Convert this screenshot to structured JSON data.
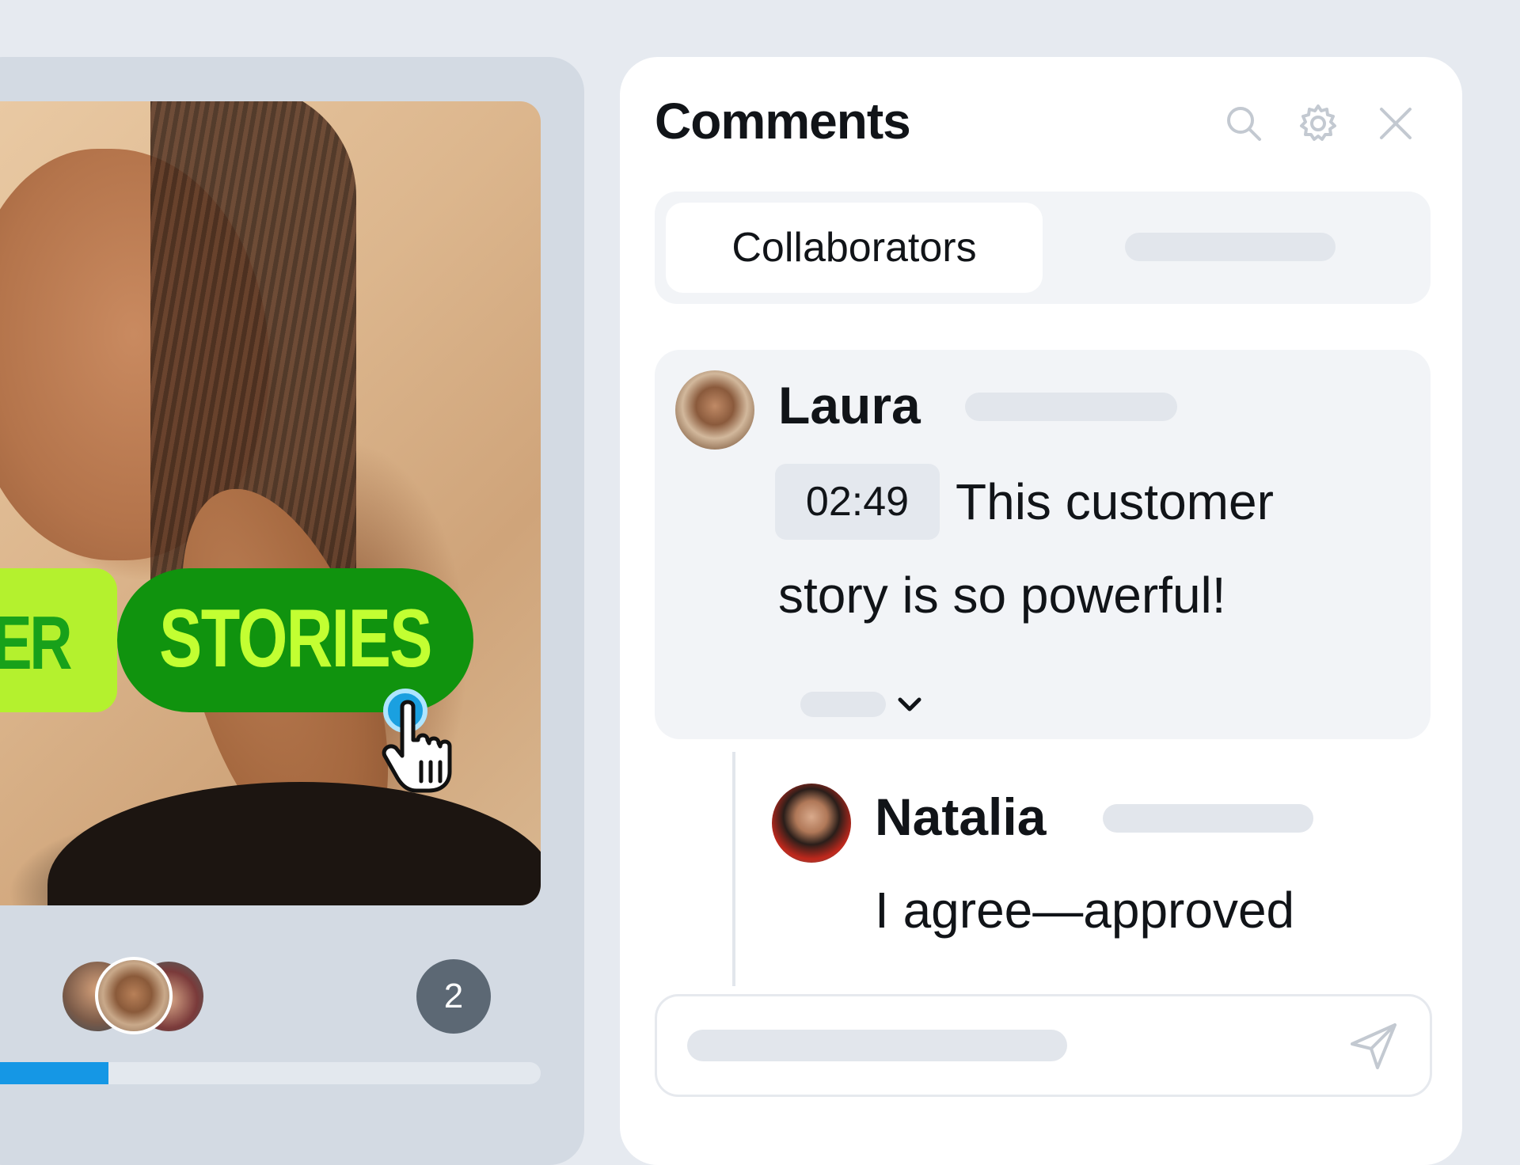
{
  "media": {
    "label_partial": "ER",
    "label_main": "STORIES"
  },
  "timeline": {
    "viewer_count": "2",
    "progress_fraction": 0.2
  },
  "comments": {
    "title": "Comments",
    "tabs": [
      "Collaborators"
    ],
    "thread": {
      "author": "Laura",
      "timestamp": "02:49",
      "text_line1": "This customer",
      "text_line2": "story is so powerful!"
    },
    "reply": {
      "author": "Natalia",
      "text": "I agree—approved"
    }
  },
  "icons": {
    "search": "search-icon",
    "settings": "gear-icon",
    "close": "close-icon",
    "expand": "chevron-down-icon",
    "send": "send-icon",
    "cursor": "hand-cursor-icon"
  },
  "colors": {
    "label_green": "#10930e",
    "label_yellow": "#b4f12e",
    "progress": "#1597e5",
    "accent_cursor": "#1aa0e0"
  }
}
